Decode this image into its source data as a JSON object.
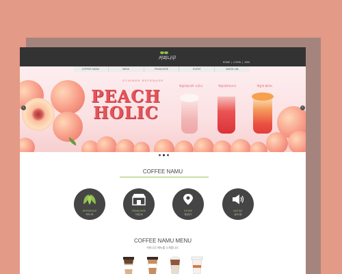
{
  "header": {
    "logo_text": "커피나무",
    "util_links": [
      "HOME",
      "|",
      "LOGIN",
      "|",
      "JOIN"
    ]
  },
  "nav": {
    "items": [
      "COFFEE NAMU",
      "MENU",
      "FRANCHISE",
      "EVENT",
      "BARIS LAB"
    ]
  },
  "hero": {
    "kicker": "SUMMER BEVERAGE",
    "title_line1": "PEACH",
    "title_line2": "HOLIC",
    "drinks": [
      "복숭아요거트 스무디",
      "복숭아아이스티",
      "복숭아 에이드"
    ],
    "prev_icon": "chevron-left-icon",
    "next_icon": "chevron-right-icon",
    "dots": 3,
    "active_dot": 1
  },
  "about": {
    "title": "COFFEE NAMU",
    "items": [
      {
        "label": "INTRODUCE",
        "sub": "커피나무",
        "icon": "leaf-icon"
      },
      {
        "label": "FRANCHISE",
        "sub": "가맹안내",
        "icon": "store-icon"
      },
      {
        "label": "STORE",
        "sub": "매장찾기",
        "icon": "map-pin-icon"
      },
      {
        "label": "NOTICE",
        "sub": "공지사항",
        "icon": "megaphone-icon"
      }
    ]
  },
  "menu": {
    "title": "COFFEE NAMU MENU",
    "subtitle": "커피나무 메뉴를 소개합니다."
  },
  "colors": {
    "background": "#e39a86",
    "topbar": "#333333",
    "accent_green": "#9bc257",
    "peach_red": "#e45358",
    "circle": "#454545"
  }
}
